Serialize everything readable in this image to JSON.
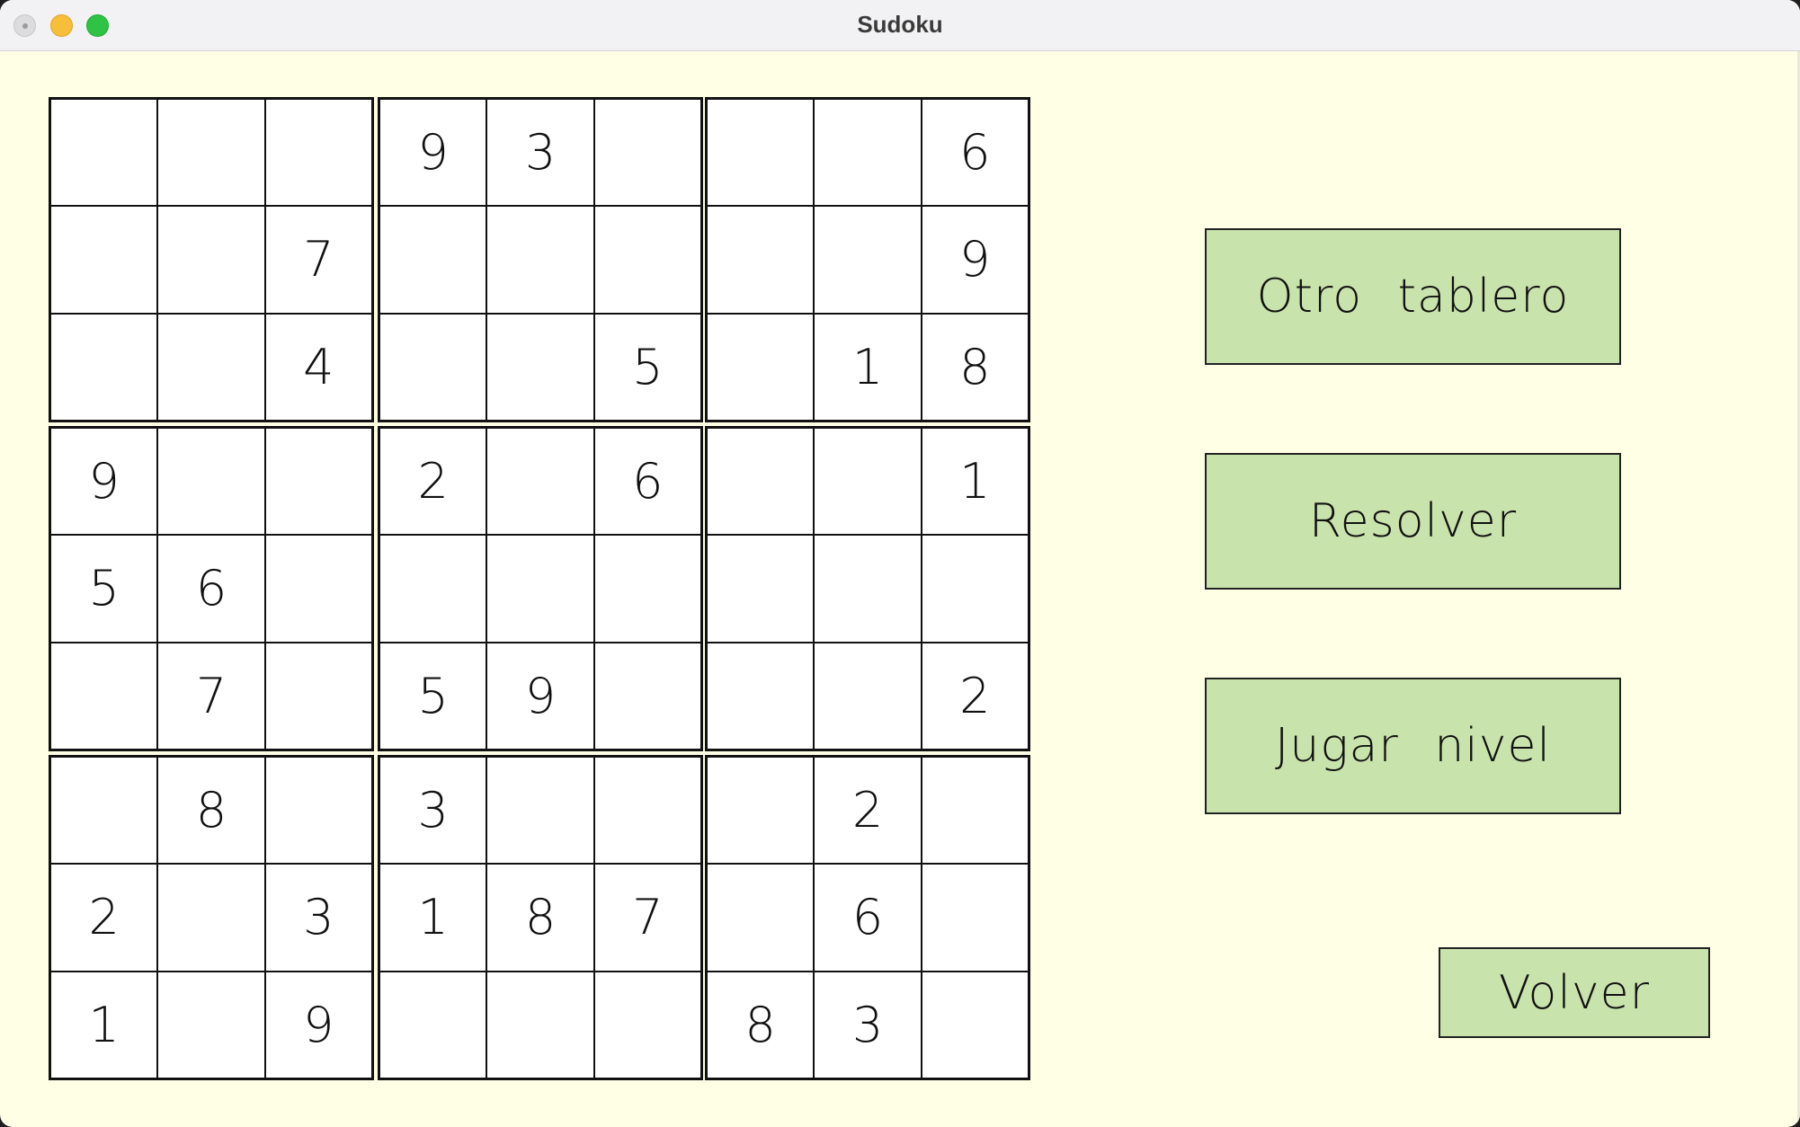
{
  "window": {
    "title": "Sudoku"
  },
  "board": {
    "rows": [
      [
        "",
        "",
        "",
        "9",
        "3",
        "",
        "",
        "",
        "6"
      ],
      [
        "",
        "",
        "7",
        "",
        "",
        "",
        "",
        "",
        "9"
      ],
      [
        "",
        "",
        "4",
        "",
        "",
        "5",
        "",
        "1",
        "8"
      ],
      [
        "9",
        "",
        "",
        "2",
        "",
        "6",
        "",
        "",
        "1"
      ],
      [
        "5",
        "6",
        "",
        "",
        "",
        "",
        "",
        "",
        ""
      ],
      [
        "",
        "7",
        "",
        "5",
        "9",
        "",
        "",
        "",
        "2"
      ],
      [
        "",
        "8",
        "",
        "3",
        "",
        "",
        "",
        "2",
        ""
      ],
      [
        "2",
        "",
        "3",
        "1",
        "8",
        "7",
        "",
        "6",
        ""
      ],
      [
        "1",
        "",
        "9",
        "",
        "",
        "",
        "8",
        "3",
        ""
      ]
    ]
  },
  "buttons": {
    "otro_tablero": "Otro tablero",
    "resolver": "Resolver",
    "jugar_nivel": "Jugar nivel",
    "volver": "Volver"
  },
  "colors": {
    "background": "#ffffe6",
    "button": "#c9e3ac",
    "cell": "#ffffff",
    "grid_line": "#111111"
  }
}
